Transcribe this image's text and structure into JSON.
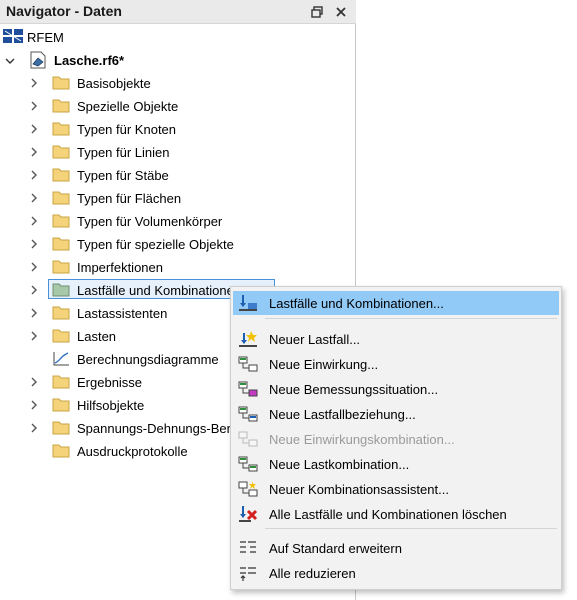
{
  "panel": {
    "title": "Navigator - Daten"
  },
  "tree": {
    "root_label": "RFEM",
    "file_label": "Lasche.rf6*",
    "items": [
      {
        "label": "Basisobjekte"
      },
      {
        "label": "Spezielle Objekte"
      },
      {
        "label": "Typen für Knoten"
      },
      {
        "label": "Typen für Linien"
      },
      {
        "label": "Typen für Stäbe"
      },
      {
        "label": "Typen für Flächen"
      },
      {
        "label": "Typen für Volumenkörper"
      },
      {
        "label": "Typen für spezielle Objekte"
      },
      {
        "label": "Imperfektionen"
      },
      {
        "label": "Lastfälle und Kombinationen"
      },
      {
        "label": "Lastassistenten"
      },
      {
        "label": "Lasten"
      },
      {
        "label": "Berechnungsdiagramme"
      },
      {
        "label": "Ergebnisse"
      },
      {
        "label": "Hilfsobjekte"
      },
      {
        "label": "Spannungs-Dehnungs-Berechnung"
      },
      {
        "label": "Ausdruckprotokolle"
      }
    ]
  },
  "context_menu": {
    "items": [
      {
        "label": "Lastfälle und Kombinationen...",
        "icon": "load-cases-icon"
      },
      {
        "label": "Neuer Lastfall...",
        "icon": "new-load-case-icon"
      },
      {
        "label": "Neue Einwirkung...",
        "icon": "new-action-icon"
      },
      {
        "label": "Neue Bemessungssituation...",
        "icon": "new-design-situation-icon"
      },
      {
        "label": "Neue Lastfallbeziehung...",
        "icon": "new-load-case-relation-icon"
      },
      {
        "label": "Neue Einwirkungskombination...",
        "icon": "new-action-combination-icon"
      },
      {
        "label": "Neue Lastkombination...",
        "icon": "new-load-combination-icon"
      },
      {
        "label": "Neuer Kombinationsassistent...",
        "icon": "new-combination-wizard-icon"
      },
      {
        "label": "Alle Lastfälle und Kombinationen löschen",
        "icon": "delete-all-icon"
      },
      {
        "label": "Auf Standard erweitern",
        "icon": "expand-icon"
      },
      {
        "label": "Alle reduzieren",
        "icon": "collapse-icon"
      }
    ]
  },
  "colors": {
    "highlight": "#91c9f7",
    "folder": "#f4d37a",
    "selected_border": "#4a90d9"
  }
}
